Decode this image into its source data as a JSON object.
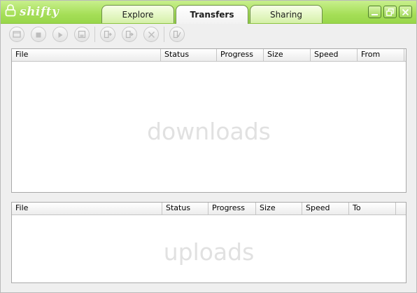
{
  "app": {
    "logo_text": "shifty"
  },
  "tabs": [
    {
      "label": "Explore",
      "active": false
    },
    {
      "label": "Transfers",
      "active": true
    },
    {
      "label": "Sharing",
      "active": false
    }
  ],
  "toolbar": {
    "icons": [
      "open-folder-icon",
      "stop-icon",
      "play-icon",
      "save-icon",
      "move-out-icon",
      "move-in-icon",
      "cancel-icon",
      "clear-done-icon"
    ]
  },
  "downloads": {
    "columns": [
      "File",
      "Status",
      "Progress",
      "Size",
      "Speed",
      "From"
    ],
    "watermark": "downloads",
    "rows": []
  },
  "uploads": {
    "columns": [
      "File",
      "Status",
      "Progress",
      "Size",
      "Speed",
      "To"
    ],
    "watermark": "uploads",
    "rows": []
  },
  "colors": {
    "accent": "#a6df58",
    "border": "#a9a9a9",
    "watermark": "#e1e1e1"
  }
}
